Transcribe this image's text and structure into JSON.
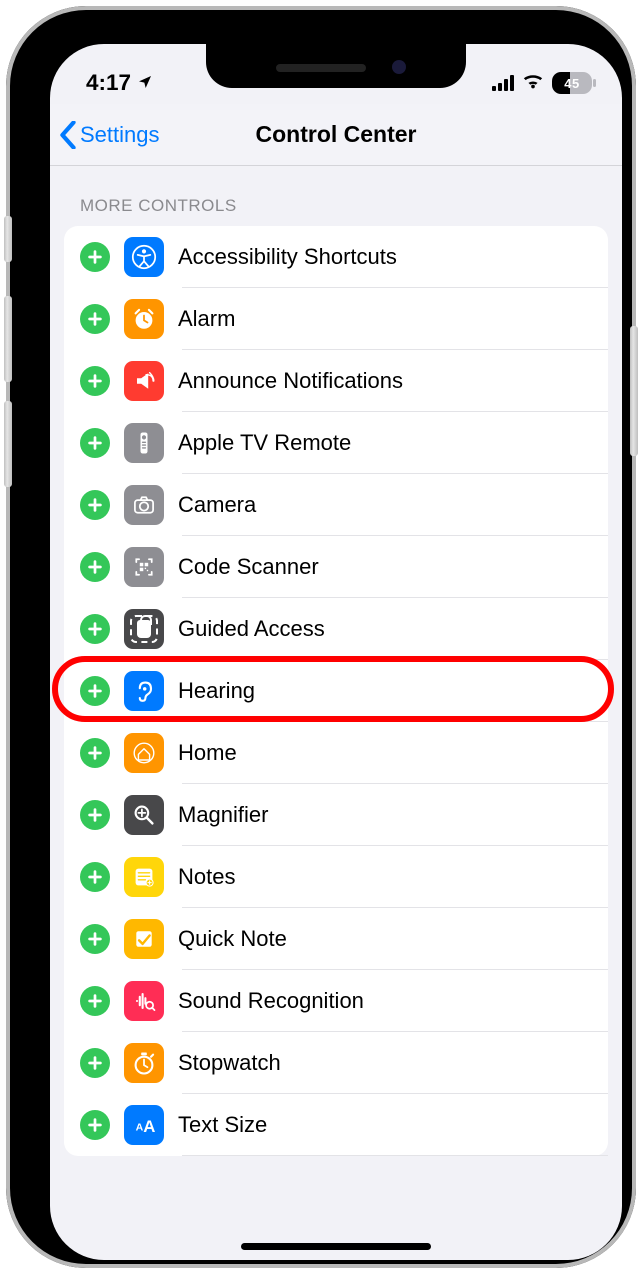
{
  "status": {
    "time": "4:17",
    "location_on": true,
    "battery_level": "45"
  },
  "nav": {
    "back_label": "Settings",
    "title": "Control Center"
  },
  "section": {
    "header": "MORE CONTROLS"
  },
  "highlight_index": 7,
  "rows": [
    {
      "id": "accessibility-shortcuts",
      "label": "Accessibility Shortcuts",
      "icon": "accessibility-icon",
      "color": "ic-blue"
    },
    {
      "id": "alarm",
      "label": "Alarm",
      "icon": "alarm-icon",
      "color": "ic-orange"
    },
    {
      "id": "announce-notifications",
      "label": "Announce Notifications",
      "icon": "announce-icon",
      "color": "ic-red"
    },
    {
      "id": "apple-tv-remote",
      "label": "Apple TV Remote",
      "icon": "remote-icon",
      "color": "ic-grey"
    },
    {
      "id": "camera",
      "label": "Camera",
      "icon": "camera-icon",
      "color": "ic-grey"
    },
    {
      "id": "code-scanner",
      "label": "Code Scanner",
      "icon": "scanner-icon",
      "color": "ic-grey"
    },
    {
      "id": "guided-access",
      "label": "Guided Access",
      "icon": "guided-access-icon",
      "color": "ic-dgrey"
    },
    {
      "id": "hearing",
      "label": "Hearing",
      "icon": "hearing-icon",
      "color": "ic-blue"
    },
    {
      "id": "home",
      "label": "Home",
      "icon": "home-icon",
      "color": "ic-orange"
    },
    {
      "id": "magnifier",
      "label": "Magnifier",
      "icon": "magnifier-icon",
      "color": "ic-dgrey"
    },
    {
      "id": "notes",
      "label": "Notes",
      "icon": "notes-icon",
      "color": "ic-yellow"
    },
    {
      "id": "quick-note",
      "label": "Quick Note",
      "icon": "quick-note-icon",
      "color": "ic-yellow2"
    },
    {
      "id": "sound-recognition",
      "label": "Sound Recognition",
      "icon": "sound-recognition-icon",
      "color": "ic-rose"
    },
    {
      "id": "stopwatch",
      "label": "Stopwatch",
      "icon": "stopwatch-icon",
      "color": "ic-orange"
    },
    {
      "id": "text-size",
      "label": "Text Size",
      "icon": "text-size-icon",
      "color": "ic-blue"
    }
  ]
}
